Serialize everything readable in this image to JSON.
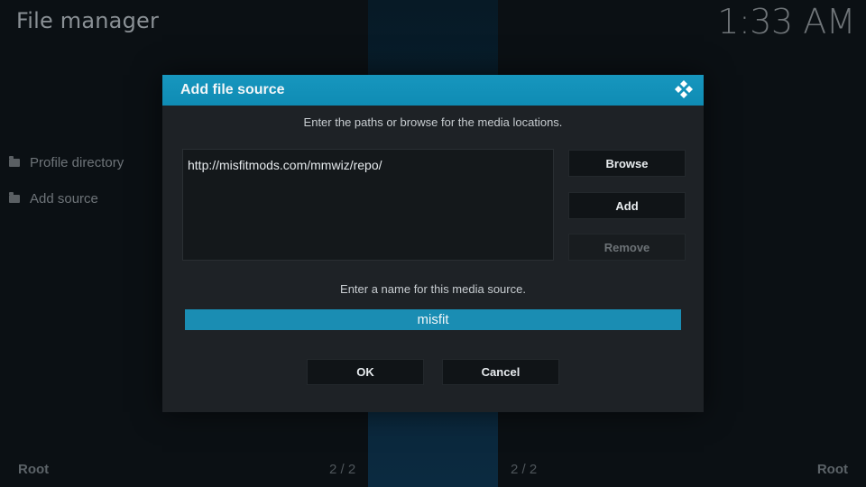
{
  "app": {
    "title": "File manager",
    "clock": "1:33 AM"
  },
  "sidebar": {
    "items": [
      {
        "label": "Profile directory",
        "icon": "folder-icon"
      },
      {
        "label": "Add source",
        "icon": "folder-icon"
      }
    ]
  },
  "footer": {
    "left_label": "Root",
    "right_label": "Root",
    "left_page": "2 / 2",
    "right_page": "2 / 2"
  },
  "dialog": {
    "title": "Add file source",
    "logo_icon": "kodi-logo-icon",
    "paths_instruction": "Enter the paths or browse for the media locations.",
    "paths": [
      "http://misfitmods.com/mmwiz/repo/"
    ],
    "browse_label": "Browse",
    "add_label": "Add",
    "remove_label": "Remove",
    "name_instruction": "Enter a name for this media source.",
    "name_value": "misfit",
    "ok_label": "OK",
    "cancel_label": "Cancel"
  },
  "colors": {
    "header": "#1796be",
    "dialog_bg": "#1e2226",
    "input_focus": "#1a8db3",
    "background": "#0b1014"
  }
}
